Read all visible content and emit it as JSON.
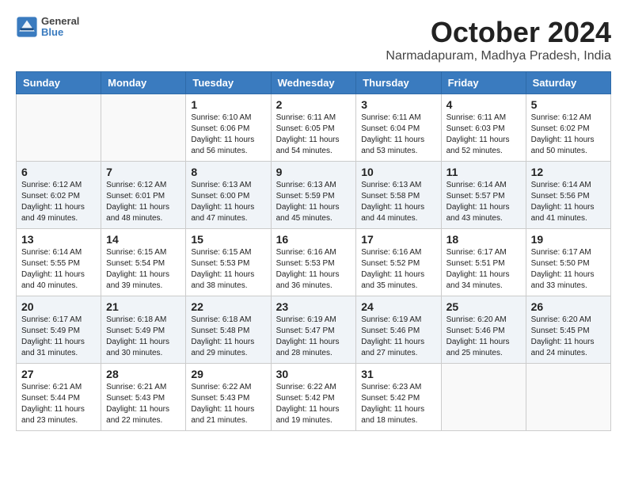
{
  "header": {
    "logo": {
      "general": "General",
      "blue": "Blue"
    },
    "title": "October 2024",
    "location": "Narmadapuram, Madhya Pradesh, India"
  },
  "weekdays": [
    "Sunday",
    "Monday",
    "Tuesday",
    "Wednesday",
    "Thursday",
    "Friday",
    "Saturday"
  ],
  "weeks": [
    [
      {
        "day": "",
        "info": ""
      },
      {
        "day": "",
        "info": ""
      },
      {
        "day": "1",
        "info": "Sunrise: 6:10 AM\nSunset: 6:06 PM\nDaylight: 11 hours and 56 minutes."
      },
      {
        "day": "2",
        "info": "Sunrise: 6:11 AM\nSunset: 6:05 PM\nDaylight: 11 hours and 54 minutes."
      },
      {
        "day": "3",
        "info": "Sunrise: 6:11 AM\nSunset: 6:04 PM\nDaylight: 11 hours and 53 minutes."
      },
      {
        "day": "4",
        "info": "Sunrise: 6:11 AM\nSunset: 6:03 PM\nDaylight: 11 hours and 52 minutes."
      },
      {
        "day": "5",
        "info": "Sunrise: 6:12 AM\nSunset: 6:02 PM\nDaylight: 11 hours and 50 minutes."
      }
    ],
    [
      {
        "day": "6",
        "info": "Sunrise: 6:12 AM\nSunset: 6:02 PM\nDaylight: 11 hours and 49 minutes."
      },
      {
        "day": "7",
        "info": "Sunrise: 6:12 AM\nSunset: 6:01 PM\nDaylight: 11 hours and 48 minutes."
      },
      {
        "day": "8",
        "info": "Sunrise: 6:13 AM\nSunset: 6:00 PM\nDaylight: 11 hours and 47 minutes."
      },
      {
        "day": "9",
        "info": "Sunrise: 6:13 AM\nSunset: 5:59 PM\nDaylight: 11 hours and 45 minutes."
      },
      {
        "day": "10",
        "info": "Sunrise: 6:13 AM\nSunset: 5:58 PM\nDaylight: 11 hours and 44 minutes."
      },
      {
        "day": "11",
        "info": "Sunrise: 6:14 AM\nSunset: 5:57 PM\nDaylight: 11 hours and 43 minutes."
      },
      {
        "day": "12",
        "info": "Sunrise: 6:14 AM\nSunset: 5:56 PM\nDaylight: 11 hours and 41 minutes."
      }
    ],
    [
      {
        "day": "13",
        "info": "Sunrise: 6:14 AM\nSunset: 5:55 PM\nDaylight: 11 hours and 40 minutes."
      },
      {
        "day": "14",
        "info": "Sunrise: 6:15 AM\nSunset: 5:54 PM\nDaylight: 11 hours and 39 minutes."
      },
      {
        "day": "15",
        "info": "Sunrise: 6:15 AM\nSunset: 5:53 PM\nDaylight: 11 hours and 38 minutes."
      },
      {
        "day": "16",
        "info": "Sunrise: 6:16 AM\nSunset: 5:53 PM\nDaylight: 11 hours and 36 minutes."
      },
      {
        "day": "17",
        "info": "Sunrise: 6:16 AM\nSunset: 5:52 PM\nDaylight: 11 hours and 35 minutes."
      },
      {
        "day": "18",
        "info": "Sunrise: 6:17 AM\nSunset: 5:51 PM\nDaylight: 11 hours and 34 minutes."
      },
      {
        "day": "19",
        "info": "Sunrise: 6:17 AM\nSunset: 5:50 PM\nDaylight: 11 hours and 33 minutes."
      }
    ],
    [
      {
        "day": "20",
        "info": "Sunrise: 6:17 AM\nSunset: 5:49 PM\nDaylight: 11 hours and 31 minutes."
      },
      {
        "day": "21",
        "info": "Sunrise: 6:18 AM\nSunset: 5:49 PM\nDaylight: 11 hours and 30 minutes."
      },
      {
        "day": "22",
        "info": "Sunrise: 6:18 AM\nSunset: 5:48 PM\nDaylight: 11 hours and 29 minutes."
      },
      {
        "day": "23",
        "info": "Sunrise: 6:19 AM\nSunset: 5:47 PM\nDaylight: 11 hours and 28 minutes."
      },
      {
        "day": "24",
        "info": "Sunrise: 6:19 AM\nSunset: 5:46 PM\nDaylight: 11 hours and 27 minutes."
      },
      {
        "day": "25",
        "info": "Sunrise: 6:20 AM\nSunset: 5:46 PM\nDaylight: 11 hours and 25 minutes."
      },
      {
        "day": "26",
        "info": "Sunrise: 6:20 AM\nSunset: 5:45 PM\nDaylight: 11 hours and 24 minutes."
      }
    ],
    [
      {
        "day": "27",
        "info": "Sunrise: 6:21 AM\nSunset: 5:44 PM\nDaylight: 11 hours and 23 minutes."
      },
      {
        "day": "28",
        "info": "Sunrise: 6:21 AM\nSunset: 5:43 PM\nDaylight: 11 hours and 22 minutes."
      },
      {
        "day": "29",
        "info": "Sunrise: 6:22 AM\nSunset: 5:43 PM\nDaylight: 11 hours and 21 minutes."
      },
      {
        "day": "30",
        "info": "Sunrise: 6:22 AM\nSunset: 5:42 PM\nDaylight: 11 hours and 19 minutes."
      },
      {
        "day": "31",
        "info": "Sunrise: 6:23 AM\nSunset: 5:42 PM\nDaylight: 11 hours and 18 minutes."
      },
      {
        "day": "",
        "info": ""
      },
      {
        "day": "",
        "info": ""
      }
    ]
  ]
}
